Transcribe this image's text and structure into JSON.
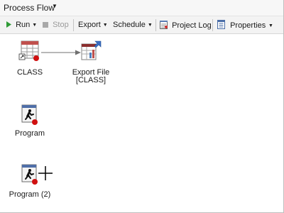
{
  "window": {
    "title": "Process Flow"
  },
  "toolbar": {
    "run": {
      "label": "Run"
    },
    "stop": {
      "label": "Stop"
    },
    "export": {
      "label": "Export"
    },
    "schedule": {
      "label": "Schedule"
    },
    "project_log": {
      "label": "Project Log"
    },
    "properties": {
      "label": "Properties"
    }
  },
  "nodes": [
    {
      "label": "CLASS"
    },
    {
      "label": "Export File",
      "label2": "[CLASS]"
    },
    {
      "label": "Program"
    },
    {
      "label": "Program (2)"
    }
  ]
}
